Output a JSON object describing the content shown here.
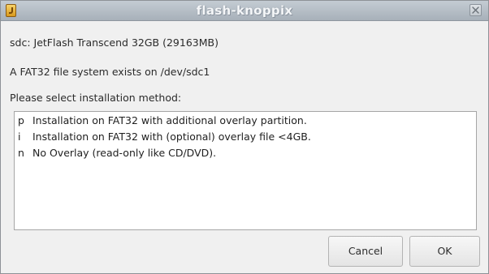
{
  "window": {
    "title": "flash-knoppix",
    "app_icon": "knoppix-app-icon",
    "close_icon": "close-icon"
  },
  "info": {
    "device_line": "sdc: JetFlash Transcend 32GB (29163MB)",
    "fs_line": "A FAT32 file system exists on /dev/sdc1",
    "prompt": "Please select installation method:"
  },
  "options": [
    {
      "key": "p",
      "label": "Installation on FAT32 with additional overlay partition."
    },
    {
      "key": "i",
      "label": "Installation on FAT32 with (optional) overlay file <4GB."
    },
    {
      "key": "n",
      "label": "No Overlay (read-only like CD/DVD)."
    }
  ],
  "buttons": {
    "cancel": "Cancel",
    "ok": "OK"
  }
}
